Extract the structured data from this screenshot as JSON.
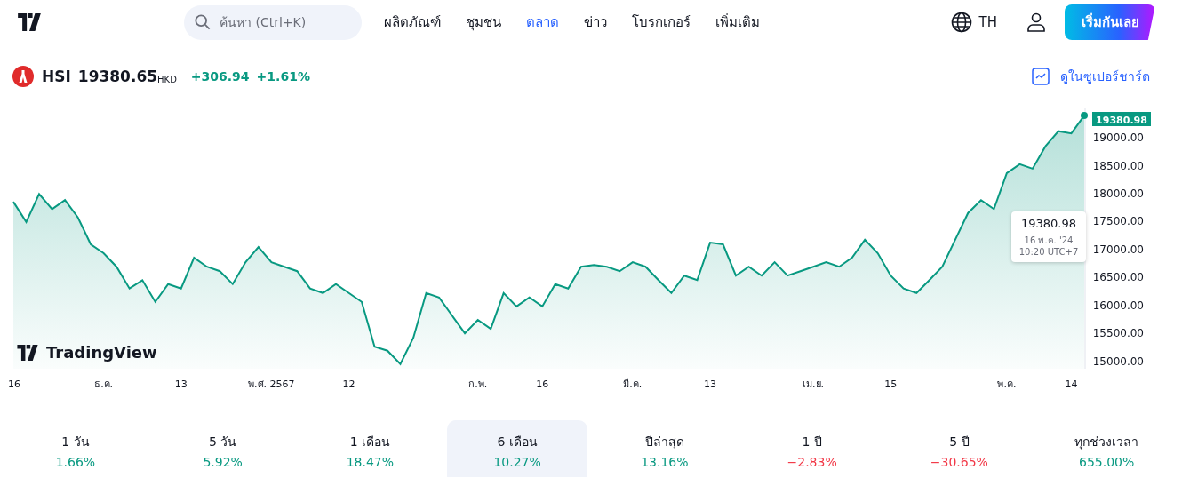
{
  "header": {
    "search": {
      "placeholder": "ค้นหา (Ctrl+K)"
    },
    "nav": [
      {
        "label": "ผลิตภัณฑ์",
        "selected": false
      },
      {
        "label": "ชุมชน",
        "selected": false
      },
      {
        "label": "ตลาด",
        "selected": true
      },
      {
        "label": "ข่าว",
        "selected": false
      },
      {
        "label": "โบรกเกอร์",
        "selected": false
      },
      {
        "label": "เพิ่มเติม",
        "selected": false
      }
    ],
    "language": "TH",
    "cta": "เริ่มกันเลย"
  },
  "symbol": {
    "ticker": "HSI",
    "price": "19380.65",
    "currency": "HKD",
    "change": "+306.94",
    "change_percent": "+1.61%",
    "link": "ดูในซูเปอร์ชาร์ต"
  },
  "chart": {
    "brand": "TradingView",
    "tooltip": {
      "value": "19380.98",
      "date": "16 พ.ค. '24",
      "time": "10:20 UTC+7"
    },
    "last_price": "19380.98",
    "chart_data": {
      "type": "area",
      "ylim": [
        14857,
        19508
      ],
      "yticks": [
        {
          "value": 19000,
          "label": "19000.00"
        },
        {
          "value": 18500,
          "label": "18500.00"
        },
        {
          "value": 18000,
          "label": "18000.00"
        },
        {
          "value": 17500,
          "label": "17500.00"
        },
        {
          "value": 17000,
          "label": "17000.00"
        },
        {
          "value": 16500,
          "label": "16500.00"
        },
        {
          "value": 16000,
          "label": "16000.00"
        },
        {
          "value": 15500,
          "label": "15500.00"
        },
        {
          "value": 15000,
          "label": "15000.00"
        }
      ],
      "categories": [
        "16",
        null,
        null,
        null,
        null,
        null,
        null,
        "ธ.ค.",
        null,
        null,
        null,
        null,
        null,
        "13",
        null,
        null,
        null,
        null,
        null,
        null,
        "พ.ศ. 2567",
        null,
        null,
        null,
        null,
        null,
        "12",
        null,
        null,
        null,
        null,
        null,
        null,
        null,
        null,
        null,
        "ก.พ.",
        null,
        null,
        null,
        null,
        "16",
        null,
        null,
        null,
        null,
        null,
        null,
        "มี.ค.",
        null,
        null,
        null,
        null,
        null,
        "13",
        null,
        null,
        null,
        null,
        null,
        null,
        null,
        "เม.ย.",
        null,
        null,
        null,
        null,
        null,
        "15",
        null,
        null,
        null,
        null,
        null,
        null,
        null,
        null,
        "พ.ค.",
        null,
        null,
        null,
        null,
        "14",
        null
      ],
      "series": [
        {
          "color": "#089981",
          "values": [
            17840,
            17480,
            17980,
            17710,
            17870,
            17560,
            17080,
            16920,
            16680,
            16290,
            16440,
            16050,
            16370,
            16290,
            16840,
            16680,
            16600,
            16370,
            16760,
            17030,
            16760,
            16680,
            16600,
            16290,
            16210,
            16370,
            16210,
            16050,
            15250,
            15180,
            14940,
            15410,
            16210,
            16130,
            15810,
            15490,
            15730,
            15570,
            16210,
            15970,
            16130,
            15970,
            16370,
            16290,
            16680,
            16710,
            16680,
            16600,
            16760,
            16680,
            16440,
            16210,
            16520,
            16440,
            17110,
            17080,
            16520,
            16680,
            16520,
            16760,
            16520,
            16600,
            16680,
            16760,
            16680,
            16840,
            17160,
            16920,
            16520,
            16290,
            16210,
            16440,
            16680,
            17160,
            17640,
            17870,
            17710,
            18350,
            18510,
            18430,
            18830,
            19100,
            19060,
            19380
          ]
        }
      ]
    }
  },
  "periods": [
    {
      "label": "1 วัน",
      "change": "1.66%",
      "color": "#089981",
      "selected": false
    },
    {
      "label": "5 วัน",
      "change": "5.92%",
      "color": "#089981",
      "selected": false
    },
    {
      "label": "1 เดือน",
      "change": "18.47%",
      "color": "#089981",
      "selected": false
    },
    {
      "label": "6 เดือน",
      "change": "10.27%",
      "color": "#089981",
      "selected": true
    },
    {
      "label": "ปีล่าสุด",
      "change": "13.16%",
      "color": "#089981",
      "selected": false
    },
    {
      "label": "1 ปี",
      "change": "−2.83%",
      "color": "#f23645",
      "selected": false
    },
    {
      "label": "5 ปี",
      "change": "−30.65%",
      "color": "#f23645",
      "selected": false
    },
    {
      "label": "ทุกช่วงเวลา",
      "change": "655.00%",
      "color": "#089981",
      "selected": false
    }
  ]
}
